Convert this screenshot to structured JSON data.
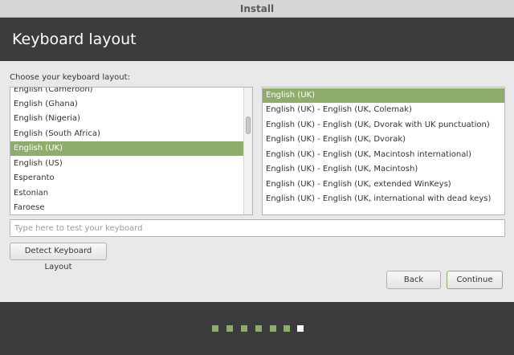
{
  "window": {
    "title": "Install"
  },
  "header": {
    "title": "Keyboard layout"
  },
  "prompt": "Choose your keyboard layout:",
  "layouts": [
    "English (Cameroon)",
    "English (Ghana)",
    "English (Nigeria)",
    "English (South Africa)",
    "English (UK)",
    "English (US)",
    "Esperanto",
    "Estonian",
    "Faroese"
  ],
  "selected_layout": "English (UK)",
  "variants": [
    "English (UK)",
    "English (UK) - English (UK, Colemak)",
    "English (UK) - English (UK, Dvorak with UK punctuation)",
    "English (UK) - English (UK, Dvorak)",
    "English (UK) - English (UK, Macintosh international)",
    "English (UK) - English (UK, Macintosh)",
    "English (UK) - English (UK, extended WinKeys)",
    "English (UK) - English (UK, international with dead keys)"
  ],
  "selected_variant": "English (UK)",
  "test_input": {
    "placeholder": "Type here to test your keyboard",
    "value": ""
  },
  "buttons": {
    "detect": "Detect Keyboard Layout",
    "back": "Back",
    "continue": "Continue"
  },
  "progress": {
    "total_steps": 7,
    "current_step": 7
  },
  "colors": {
    "accent": "#8fad6a",
    "header_bg": "#3c3c3c",
    "content_bg": "#e9e9e9"
  }
}
